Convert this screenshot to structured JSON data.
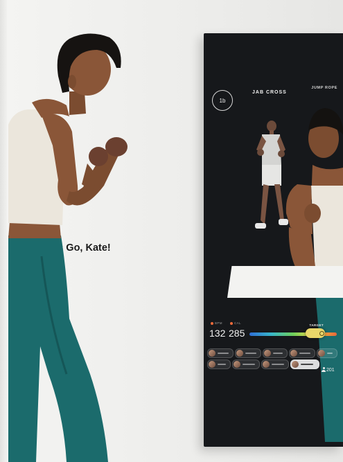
{
  "mirror": {
    "ring_caption": "",
    "timer": "1b",
    "current_move": "JAB CROSS",
    "next_move_caption": "",
    "next_move": "JUMP ROPE",
    "banner": "Let's Go, Kate!",
    "stats": {
      "bpm_caption": "BPM",
      "bpm_value": "132",
      "cal_caption": "CAL",
      "cal_value": "285",
      "target_caption": "TARGET",
      "target_level": 0.75
    },
    "participants_count": "201"
  },
  "colors": {
    "mirror_bg": "#16181b",
    "wall": "#efefed",
    "top": "#ebe6dc",
    "leggings": "#1b6b6c",
    "skin": "#8a5638",
    "accent": "#f26b3a"
  },
  "icons": {
    "participants": "person-icon"
  }
}
